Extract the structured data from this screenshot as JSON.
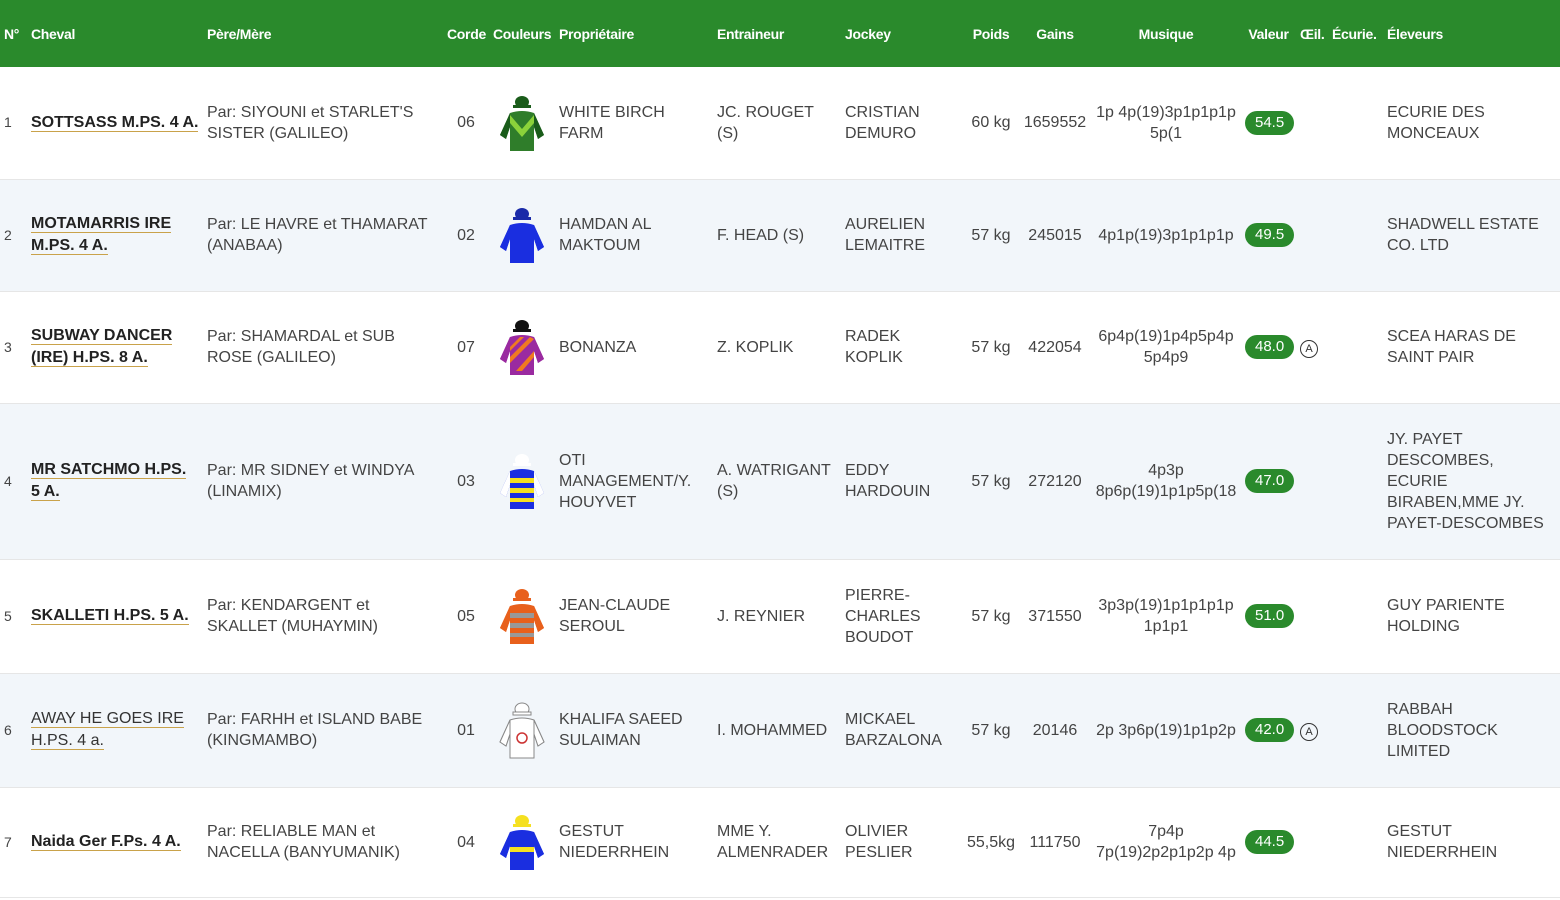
{
  "headers": {
    "no": "N°",
    "cheval": "Cheval",
    "pere_mere": "Père/Mère",
    "corde": "Corde",
    "couleurs": "Couleurs",
    "proprietaire": "Propriétaire",
    "entraineur": "Entraineur",
    "jockey": "Jockey",
    "poids": "Poids",
    "gains": "Gains",
    "musique": "Musique",
    "valeur": "Valeur",
    "oeil": "Œil.",
    "ecurie": "Écurie.",
    "eleveurs": "Éleveurs"
  },
  "rows": [
    {
      "no": "1",
      "cheval": "SOTTSASS M.PS. 4 A.",
      "pere_mere": "Par: SIYOUNI et STARLET'S SISTER (GALILEO)",
      "corde": "06",
      "colors": {
        "cap": "#1a5c1a",
        "body": "#2f7d2a",
        "stripe": "#8bd23a",
        "sleeve": "#1a5c1a",
        "pattern": "chevron"
      },
      "proprietaire": "WHITE BIRCH FARM",
      "entraineur": "JC. ROUGET (S)",
      "jockey": "CRISTIAN DEMURO",
      "poids": "60 kg",
      "gains": "1659552",
      "musique": "1p 4p(19)3p1p1p1p 5p(1",
      "valeur": "54.5",
      "oeil": "",
      "ecurie": "",
      "eleveurs": "ECURIE DES MONCEAUX"
    },
    {
      "no": "2",
      "cheval": "MOTAMARRIS IRE M.PS. 4 A.",
      "pere_mere": "Par: LE HAVRE et THAMARAT (ANABAA)",
      "corde": "02",
      "colors": {
        "cap": "#1a2aa8",
        "body": "#1a2ee0",
        "stripe": "#1a2ee0",
        "sleeve": "#1a2ee0",
        "pattern": "plain"
      },
      "proprietaire": "HAMDAN AL MAKTOUM",
      "entraineur": "F. HEAD (S)",
      "jockey": "AURELIEN LEMAITRE",
      "poids": "57 kg",
      "gains": "245015",
      "musique": "4p1p(19)3p1p1p1p",
      "valeur": "49.5",
      "oeil": "",
      "ecurie": "",
      "eleveurs": "SHADWELL ESTATE CO. LTD"
    },
    {
      "no": "3",
      "cheval": "SUBWAY DANCER (IRE) H.PS. 8 A.",
      "pere_mere": "Par: SHAMARDAL et SUB ROSE (GALILEO)",
      "corde": "07",
      "colors": {
        "cap": "#111111",
        "body": "#9a2aa0",
        "stripe": "#f07a20",
        "sleeve": "#9a2aa0",
        "pattern": "diagonal"
      },
      "proprietaire": "BONANZA",
      "entraineur": "Z. KOPLIK",
      "jockey": "RADEK KOPLIK",
      "poids": "57 kg",
      "gains": "422054",
      "musique": "6p4p(19)1p4p5p4p 5p4p9",
      "valeur": "48.0",
      "oeil": "A",
      "ecurie": "",
      "eleveurs": "SCEA HARAS DE SAINT PAIR"
    },
    {
      "no": "4",
      "cheval": "MR SATCHMO H.PS. 5 A.",
      "pere_mere": "Par: MR SIDNEY et WINDYA (LINAMIX)",
      "corde": "03",
      "colors": {
        "cap": "#ffffff",
        "body": "#1a2ee0",
        "stripe": "#f5e020",
        "sleeve": "#ffffff",
        "pattern": "hoops"
      },
      "proprietaire": "OTI MANAGEMENT/Y. HOUYVET",
      "entraineur": "A. WATRIGANT (S)",
      "jockey": "EDDY HARDOUIN",
      "poids": "57 kg",
      "gains": "272120",
      "musique": "4p3p 8p6p(19)1p1p5p(18",
      "valeur": "47.0",
      "oeil": "",
      "ecurie": "",
      "eleveurs": "JY. PAYET DESCOMBES, ECURIE BIRABEN,MME JY. PAYET-DESCOMBES"
    },
    {
      "no": "5",
      "cheval": "SKALLETI H.PS. 5 A.",
      "pere_mere": "Par: KENDARGENT et SKALLET (MUHAYMIN)",
      "corde": "05",
      "colors": {
        "cap": "#e8601c",
        "body": "#e8601c",
        "stripe": "#999999",
        "sleeve": "#e8601c",
        "pattern": "hoops"
      },
      "proprietaire": "JEAN-CLAUDE SEROUL",
      "entraineur": "J. REYNIER",
      "jockey": "PIERRE-CHARLES BOUDOT",
      "poids": "57 kg",
      "gains": "371550",
      "musique": "3p3p(19)1p1p1p1p 1p1p1",
      "valeur": "51.0",
      "oeil": "",
      "ecurie": "",
      "eleveurs": "GUY PARIENTE HOLDING"
    },
    {
      "no": "6",
      "cheval": "AWAY HE GOES IRE H.PS. 4 a.",
      "pere_mere": "Par: FARHH et ISLAND BABE (KINGMAMBO)",
      "corde": "01",
      "colors": {
        "cap": "#ffffff",
        "body": "#ffffff",
        "stripe": "#cc3333",
        "sleeve": "#ffffff",
        "pattern": "emblem"
      },
      "proprietaire": "KHALIFA SAEED SULAIMAN",
      "entraineur": "I. MOHAMMED",
      "jockey": "MICKAEL BARZALONA",
      "poids": "57 kg",
      "gains": "20146",
      "musique": "2p 3p6p(19)1p1p2p",
      "valeur": "42.0",
      "oeil": "A",
      "ecurie": "",
      "eleveurs": "RABBAH BLOODSTOCK LIMITED"
    },
    {
      "no": "7",
      "cheval": "Naida Ger F.Ps. 4 A.",
      "pere_mere": "Par: RELIABLE MAN et NACELLA (BANYUMANIK)",
      "corde": "04",
      "colors": {
        "cap": "#f5e020",
        "body": "#1a2ee0",
        "stripe": "#f5e020",
        "sleeve": "#1a2ee0",
        "pattern": "band"
      },
      "proprietaire": "GESTUT NIEDERRHEIN",
      "entraineur": "MME Y. ALMENRADER",
      "jockey": "OLIVIER PESLIER",
      "poids": "55,5kg",
      "gains": "111750",
      "musique": "7p4p 7p(19)2p2p1p2p 4p",
      "valeur": "44.5",
      "oeil": "",
      "ecurie": "",
      "eleveurs": "GESTUT NIEDERRHEIN"
    }
  ]
}
